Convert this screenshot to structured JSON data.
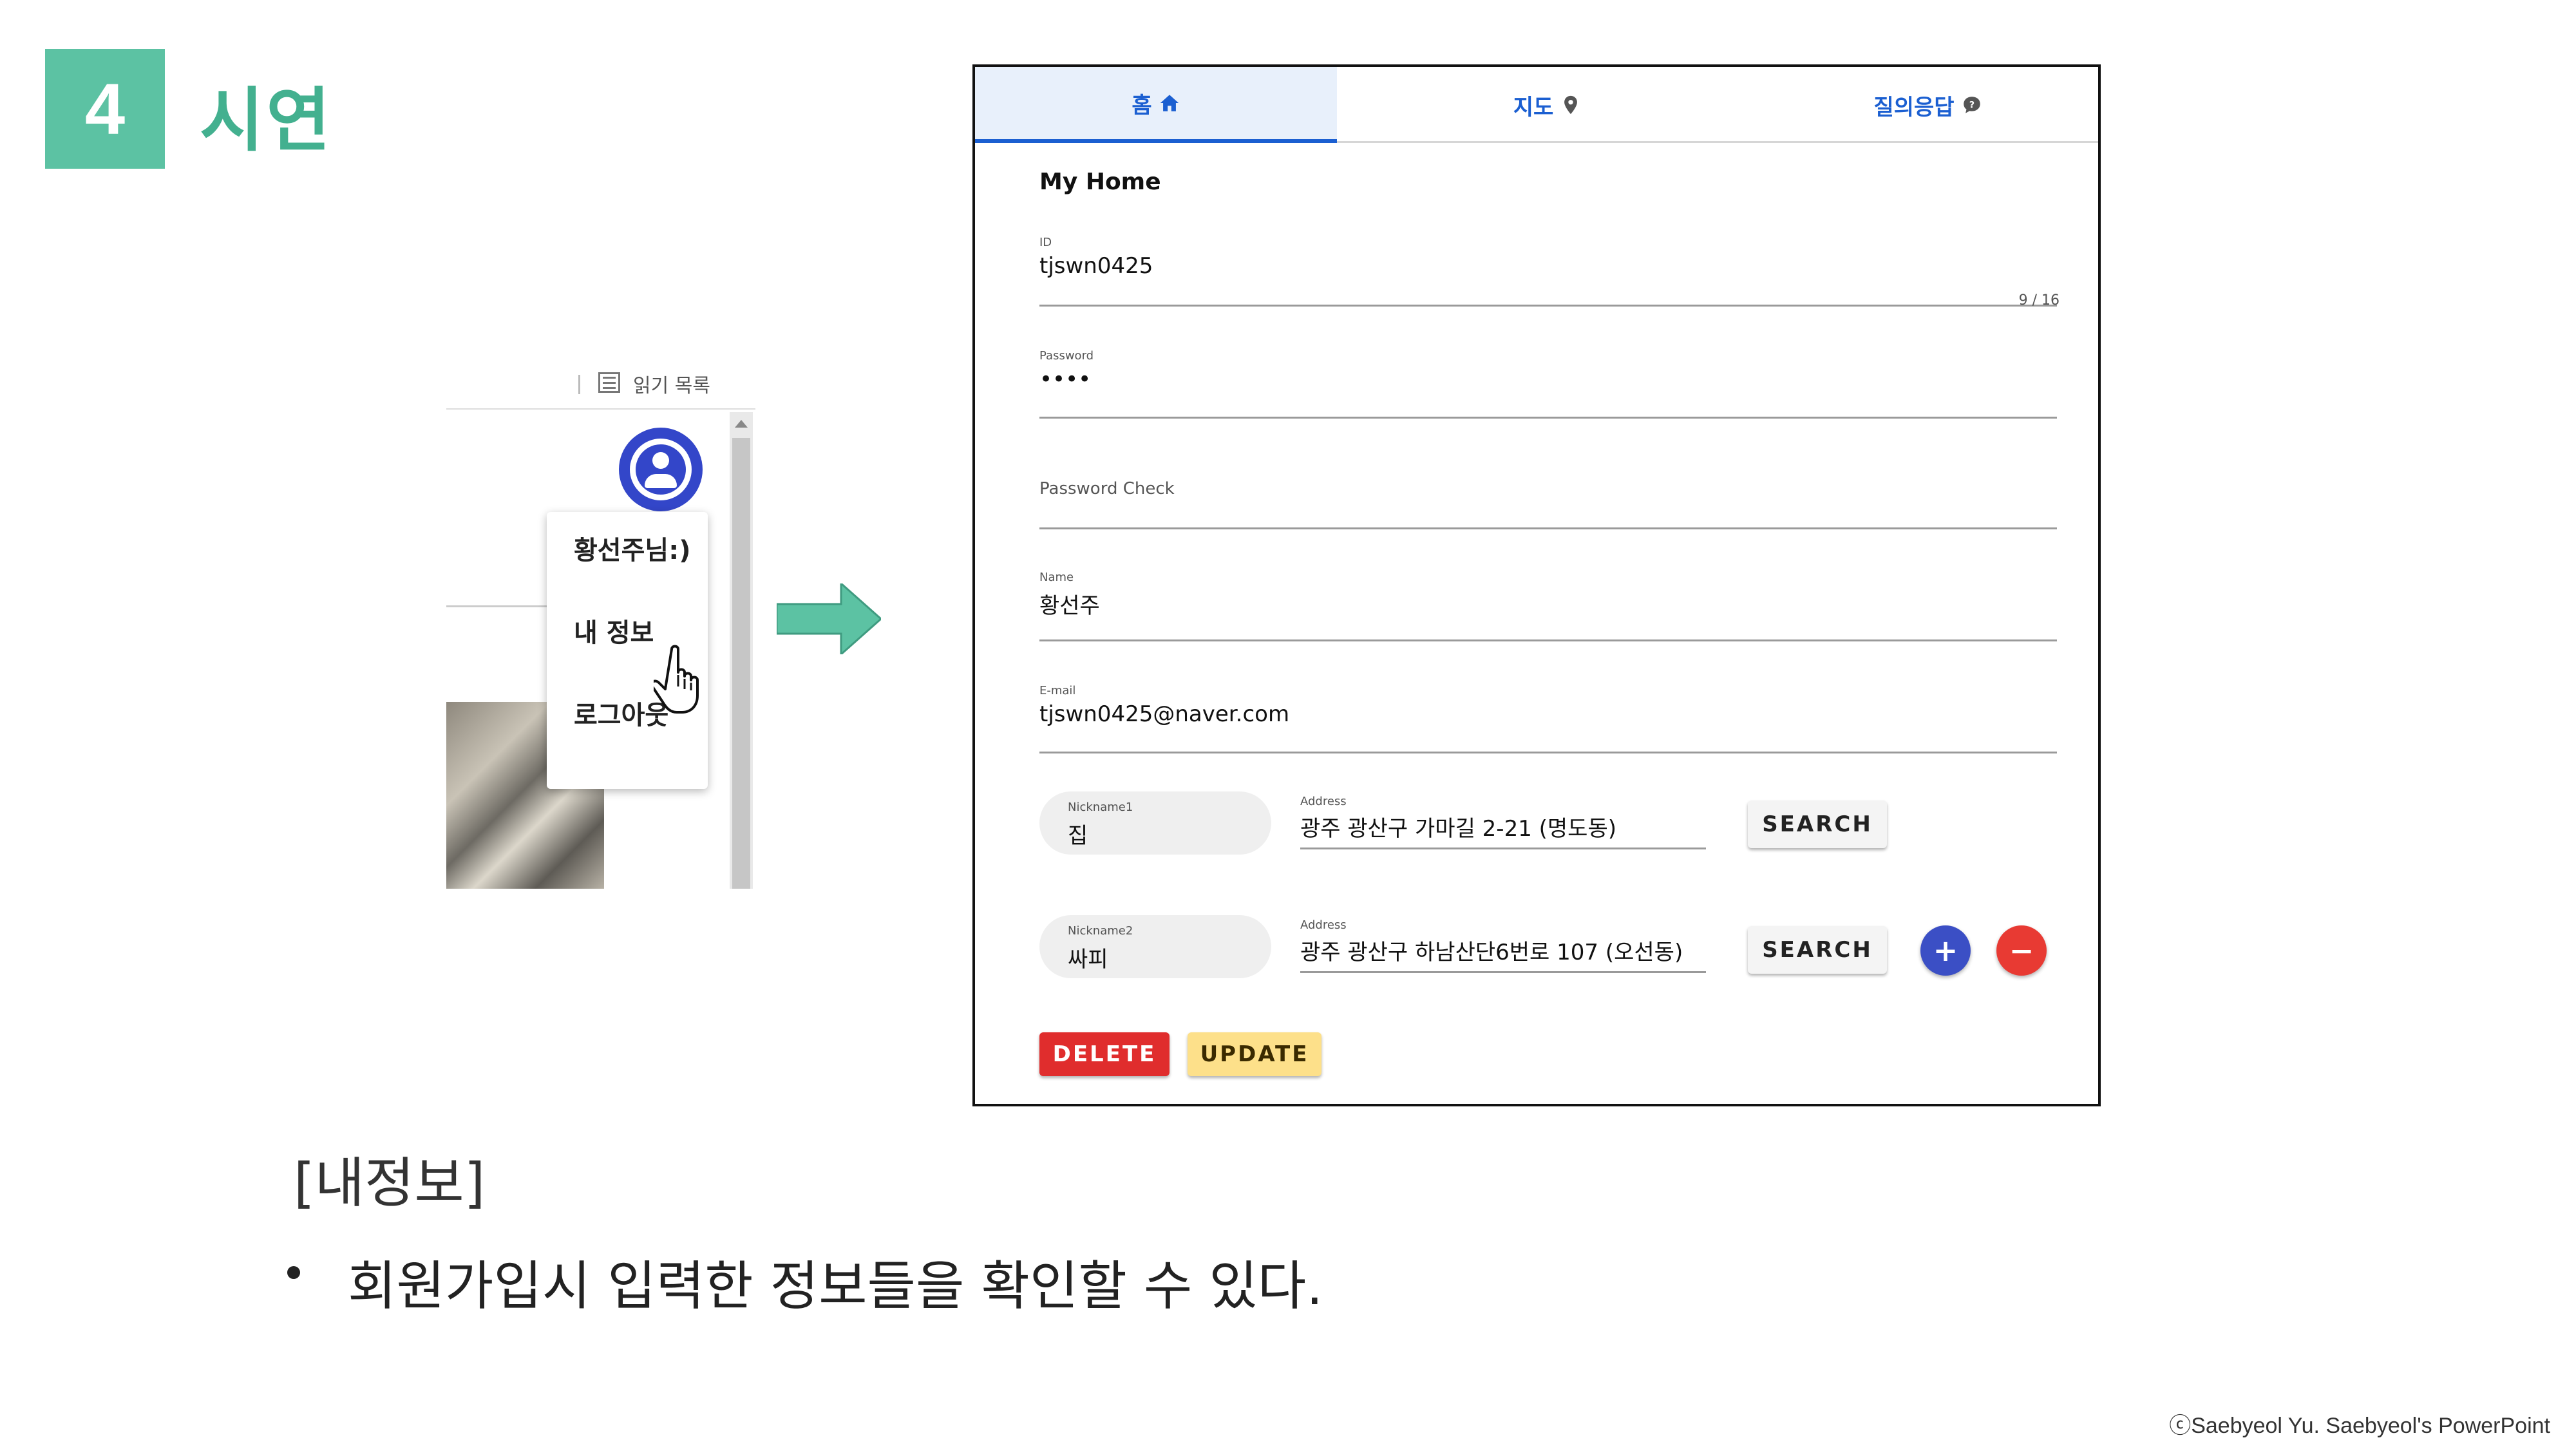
{
  "slide": {
    "number": "4",
    "title": "시연",
    "section_label": "[내정보]",
    "bullet": "회원가입시 입력한 정보들을 확인할 수 있다.",
    "copyright": "ⓒSaebyeol Yu. Saebyeol's PowerPoint"
  },
  "dropdown_demo": {
    "menu_items": [
      "황선주님:)",
      "내 정보",
      "로그아웃"
    ]
  },
  "app": {
    "tabs": [
      {
        "label": "홈",
        "icon": "home-icon"
      },
      {
        "label": "지도",
        "icon": "map-pin-icon"
      },
      {
        "label": "질의응답",
        "icon": "question-bubble-icon"
      }
    ],
    "page_title": "My Home",
    "fields": {
      "id": {
        "label": "ID",
        "value": "tjswn0425",
        "counter": "9 / 16"
      },
      "password": {
        "label": "Password",
        "value": "••••"
      },
      "password_check": {
        "label": "Password Check",
        "value": ""
      },
      "name": {
        "label": "Name",
        "value": "황선주"
      },
      "email": {
        "label": "E-mail",
        "value": "tjswn0425@naver.com"
      }
    },
    "addresses": [
      {
        "nickname_label": "Nickname1",
        "nickname": "집",
        "address_label": "Address",
        "address": "광주 광산구 가마길 2-21 (명도동)",
        "search_label": "SEARCH"
      },
      {
        "nickname_label": "Nickname2",
        "nickname": "싸피",
        "address_label": "Address",
        "address": "광주 광산구 하남산단6번로 107 (오선동)",
        "search_label": "SEARCH"
      }
    ],
    "add_label": "+",
    "remove_label": "−",
    "delete_label": "DELETE",
    "update_label": "UPDATE"
  },
  "colors": {
    "accent_green": "#5cc2a3",
    "tab_blue": "#1b5fd1",
    "avatar_blue": "#3346c9",
    "delete_red": "#e02d2d",
    "update_yellow": "#fde08a"
  }
}
